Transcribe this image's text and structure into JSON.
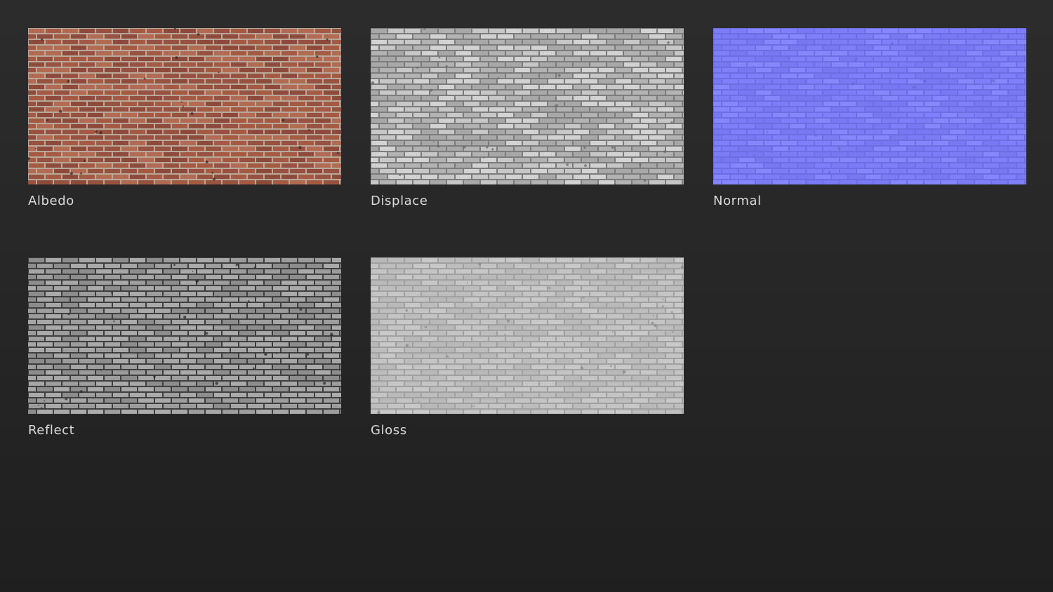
{
  "maps": [
    {
      "label": "Albedo",
      "colors": {
        "base": "#9a5240",
        "brick_a": "#a65a44",
        "brick_b": "#8e4a3a",
        "brick_c": "#b36a52",
        "mortar": "#b8a89a",
        "spot": "#3a2a25"
      }
    },
    {
      "label": "Displace",
      "colors": {
        "base": "#a8a8a8",
        "brick_a": "#c6c6c6",
        "brick_b": "#b2b2b2",
        "brick_c": "#d2d2d2",
        "mortar": "#7c7c7c",
        "spot": "#6a6a6a"
      }
    },
    {
      "label": "Normal",
      "colors": {
        "base": "#7c7cf6",
        "brick_a": "#8080fb",
        "brick_b": "#7878f2",
        "brick_c": "#8686ff",
        "mortar": "#6e6ee0",
        "spot": "#6a6ad8"
      }
    },
    {
      "label": "Reflect",
      "colors": {
        "base": "#8c8c8c",
        "brick_a": "#a6a6a6",
        "brick_b": "#9c9c9c",
        "brick_c": "#aaaaaa",
        "mortar": "#3f3f3f",
        "spot": "#2a2a2a"
      }
    },
    {
      "label": "Gloss",
      "colors": {
        "base": "#b9b9b9",
        "brick_a": "#c4c4c4",
        "brick_b": "#bdbdbd",
        "brick_c": "#c8c8c8",
        "mortar": "#a0a0a0",
        "spot": "#8a8a8a"
      }
    }
  ]
}
